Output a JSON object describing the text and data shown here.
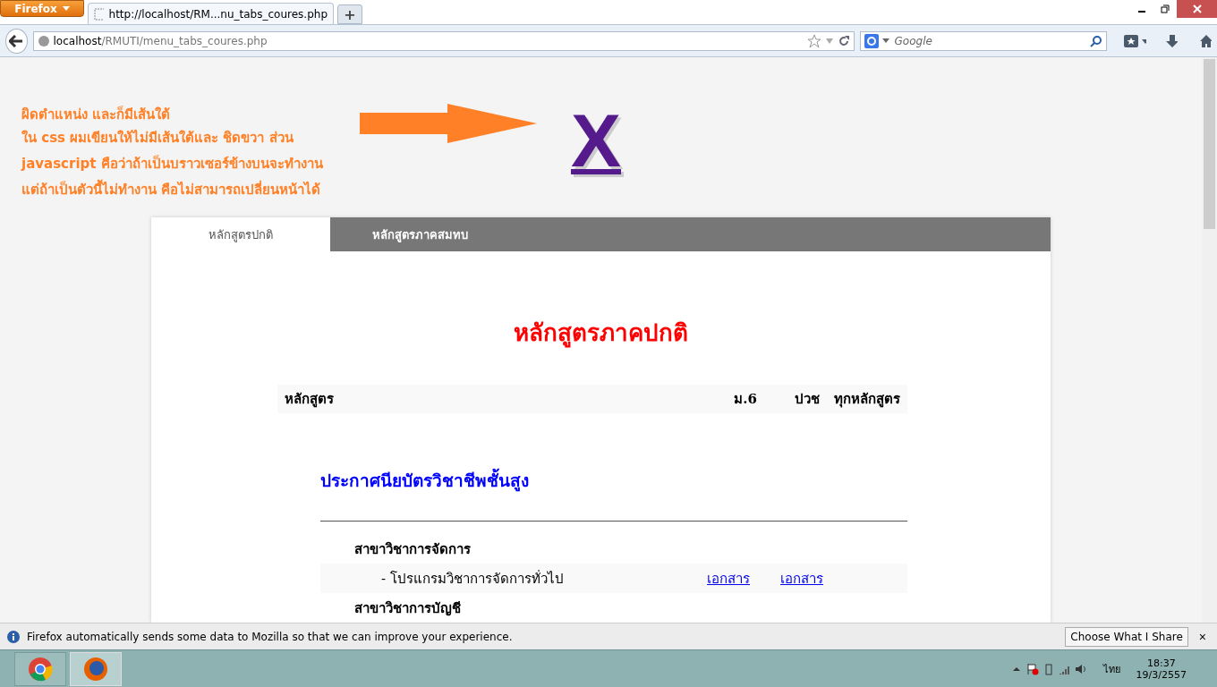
{
  "browser": {
    "menu_button": "Firefox",
    "tabs": [
      {
        "title": "http://localhost/RM...nu_tabs_coures.php",
        "selected": true
      }
    ],
    "new_tab": "+",
    "address": {
      "host": "localhost",
      "path": "/RMUTI/menu_tabs_coures.php"
    },
    "search": {
      "placeholder": "Google"
    }
  },
  "note": {
    "lines": [
      "ผิดตำแหน่ง และก็มีเส้นใต้",
      "ใน **css** ผมเขียนให้ไม่มีเส้นใต้และ ชิดขวา  ส่วน",
      "**javascript**  คือว่าถ้าเป็นบราวเซอร์ข้างบนจะทำงาน",
      "แต่ถ้าเป็นตัวนี้ไม่ทำงาน คือไม่สามารถเปลี่ยนหน้าได้"
    ],
    "mark": "X"
  },
  "card": {
    "tabs": [
      {
        "label": "หลักสูตรปกติ",
        "selected": true
      },
      {
        "label": "หลักสูตรภาคสมทบ",
        "selected": false
      }
    ],
    "title": "หลักสูตรภาคปกติ",
    "columns": [
      "หลักสูตร",
      "ม.6",
      "ปวช",
      "ทุกหลักสูตร"
    ],
    "sections": [
      {
        "heading": "ประกาศนียบัตรวิชาชีพชั้นสูง",
        "rows": [
          {
            "kind": "group",
            "label": "สาขาวิชาการจัดการ"
          },
          {
            "kind": "program",
            "label": "- โปรแกรมวิชาการจัดการทั่วไป",
            "links": [
              "เอกสาร",
              "เอกสาร"
            ]
          },
          {
            "kind": "group",
            "label": "สาขาวิชาการบัญชี"
          }
        ]
      }
    ]
  },
  "notification": {
    "text": "Firefox automatically sends some data to Mozilla so that we can improve your experience.",
    "button": "Choose What I Share",
    "close": "×"
  },
  "taskbar": {
    "language": "ไทย",
    "time": "18:37",
    "date": "19/3/2557"
  }
}
